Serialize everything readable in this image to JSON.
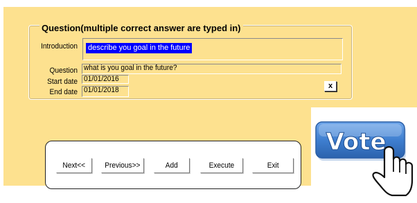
{
  "form": {
    "group_title": "Question(multiple correct answer are typed in)",
    "introduction": {
      "label": "Introduction",
      "value": "describe you goal in the future"
    },
    "question": {
      "label": "Question",
      "value": "what is you goal in the future?"
    },
    "start_date": {
      "label": "Start date",
      "value": "01/01/2016"
    },
    "end_date": {
      "label": "End date",
      "value": "01/01/2018"
    },
    "close_label": "x"
  },
  "buttons": {
    "next": "Next<<",
    "previous": "Previous>>",
    "add": "Add",
    "execute": "Execute",
    "exit": "Exit"
  },
  "vote_graphic": {
    "text": "Vote",
    "icon": "hand-pointer-icon"
  },
  "colors": {
    "background": "#fde18f",
    "selection": "#0000ff",
    "vote_blue": "#3f7fd0"
  }
}
